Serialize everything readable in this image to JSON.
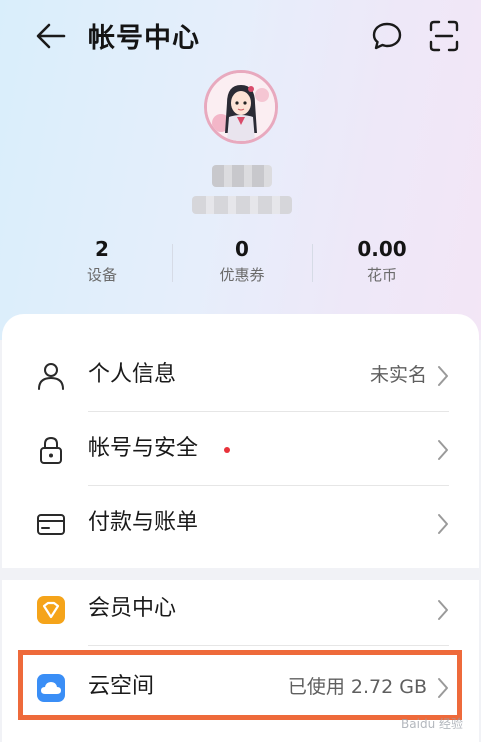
{
  "header": {
    "title": "帐号中心",
    "icons": [
      "back-arrow-icon",
      "message-bubble-icon",
      "scan-icon"
    ]
  },
  "profile": {
    "avatar": "anime-girl-avatar"
  },
  "stats": [
    {
      "value": "2",
      "label": "设备"
    },
    {
      "value": "0",
      "label": "优惠券"
    },
    {
      "value": "0.00",
      "label": "花币"
    }
  ],
  "menu_group1": [
    {
      "label": "个人信息",
      "value": "未实名",
      "icon": "person-icon"
    },
    {
      "label": "帐号与安全",
      "value": "",
      "icon": "lock-icon",
      "badge": "red-dot"
    },
    {
      "label": "付款与账单",
      "value": "",
      "icon": "card-icon"
    }
  ],
  "menu_group2": [
    {
      "label": "会员中心",
      "value": "",
      "icon": "vip-badge-icon"
    },
    {
      "label": "云空间",
      "value": "已使用 2.72 GB",
      "icon": "cloud-icon"
    }
  ],
  "colors": {
    "highlight_border": "#ee6a3b",
    "vip_icon": "#f5a41a",
    "cloud_icon": "#3a8ef6",
    "badge_dot": "#e8323a"
  }
}
